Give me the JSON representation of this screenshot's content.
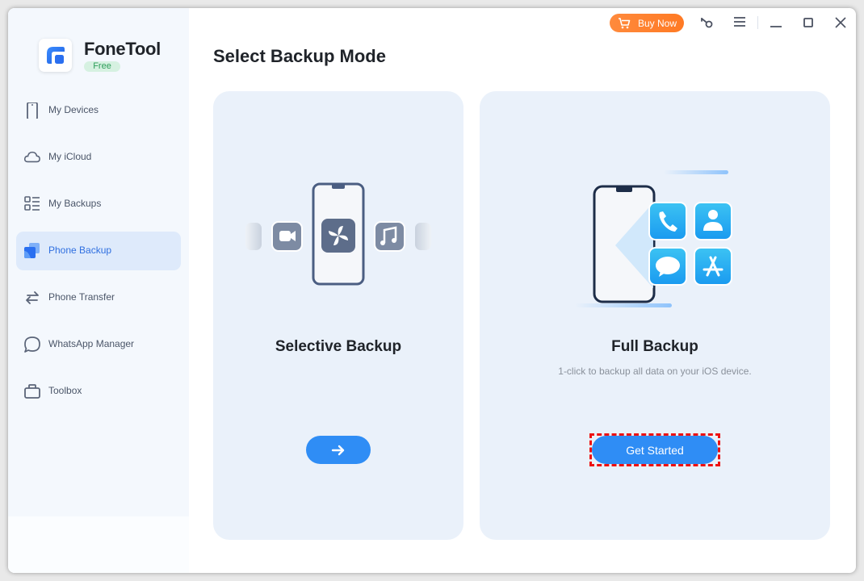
{
  "app": {
    "name": "FoneTool",
    "edition_badge": "Free"
  },
  "topbar": {
    "buy_label": "Buy Now",
    "icons": [
      "cart-icon",
      "key-icon",
      "menu-icon",
      "minimize-icon",
      "maximize-icon",
      "close-icon"
    ]
  },
  "sidebar": {
    "items": [
      {
        "label": "My Devices",
        "icon": "phone-icon"
      },
      {
        "label": "My iCloud",
        "icon": "cloud-icon"
      },
      {
        "label": "My Backups",
        "icon": "list-icon"
      },
      {
        "label": "Phone Backup",
        "icon": "backup-icon",
        "active": true
      },
      {
        "label": "Phone Transfer",
        "icon": "transfer-icon"
      },
      {
        "label": "WhatsApp Manager",
        "icon": "chat-icon"
      },
      {
        "label": "Toolbox",
        "icon": "toolbox-icon"
      }
    ]
  },
  "main": {
    "title": "Select Backup Mode",
    "cards": [
      {
        "title": "Selective Backup",
        "description": "",
        "button_icon": "arrow-right-icon"
      },
      {
        "title": "Full Backup",
        "description": "1-click to backup all data on your iOS device.",
        "button_label": "Get Started"
      }
    ]
  },
  "colors": {
    "accent": "#2f8df5",
    "buy": "#ff7a24",
    "active_nav": "#2f6fe0",
    "highlight": "#ee1111"
  }
}
